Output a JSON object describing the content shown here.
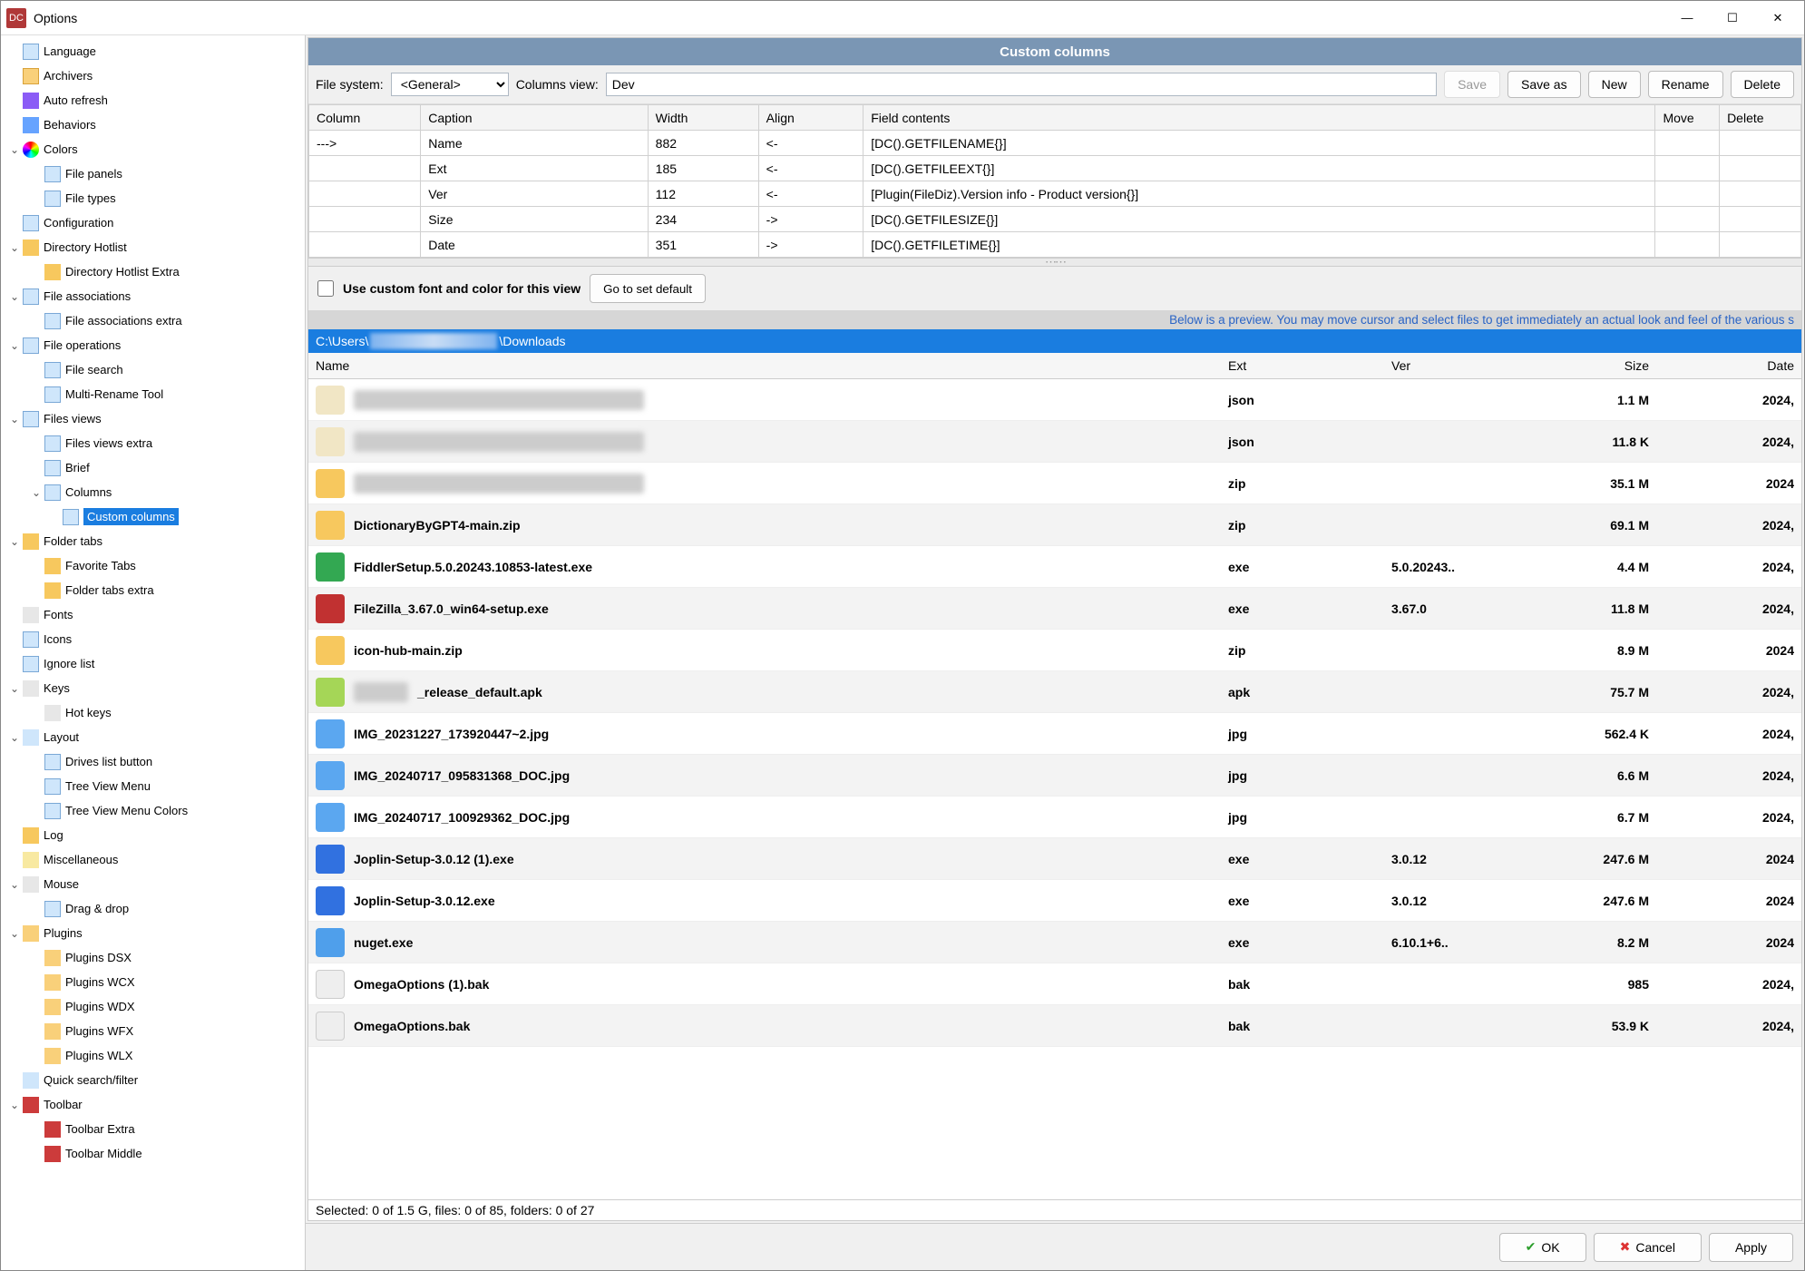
{
  "title": "Options",
  "sidebar": {
    "items": [
      {
        "label": "Language",
        "lvl": 0,
        "exp": "",
        "icoClass": "ico-blue"
      },
      {
        "label": "Archivers",
        "lvl": 0,
        "exp": "",
        "icoClass": "ico-orange"
      },
      {
        "label": "Auto refresh",
        "lvl": 0,
        "exp": "",
        "icoClass": "ico-purple"
      },
      {
        "label": "Behaviors",
        "lvl": 0,
        "exp": "",
        "icoClass": "ico-video"
      },
      {
        "label": "Colors",
        "lvl": 0,
        "exp": "⌄",
        "icoClass": "ico-color"
      },
      {
        "label": "File panels",
        "lvl": 1,
        "exp": "",
        "icoClass": "ico-blue"
      },
      {
        "label": "File types",
        "lvl": 1,
        "exp": "",
        "icoClass": "ico-blue"
      },
      {
        "label": "Configuration",
        "lvl": 0,
        "exp": "",
        "icoClass": "ico-blue"
      },
      {
        "label": "Directory Hotlist",
        "lvl": 0,
        "exp": "⌄",
        "icoClass": "ico-folder"
      },
      {
        "label": "Directory Hotlist Extra",
        "lvl": 1,
        "exp": "",
        "icoClass": "ico-folder"
      },
      {
        "label": "File associations",
        "lvl": 0,
        "exp": "⌄",
        "icoClass": "ico-blue"
      },
      {
        "label": "File associations extra",
        "lvl": 1,
        "exp": "",
        "icoClass": "ico-blue"
      },
      {
        "label": "File operations",
        "lvl": 0,
        "exp": "⌄",
        "icoClass": "ico-blue"
      },
      {
        "label": "File search",
        "lvl": 1,
        "exp": "",
        "icoClass": "ico-blue"
      },
      {
        "label": "Multi-Rename Tool",
        "lvl": 1,
        "exp": "",
        "icoClass": "ico-blue"
      },
      {
        "label": "Files views",
        "lvl": 0,
        "exp": "⌄",
        "icoClass": "ico-blue"
      },
      {
        "label": "Files views extra",
        "lvl": 1,
        "exp": "",
        "icoClass": "ico-blue"
      },
      {
        "label": "Brief",
        "lvl": 1,
        "exp": "",
        "icoClass": "ico-blue"
      },
      {
        "label": "Columns",
        "lvl": 1,
        "exp": "⌄",
        "icoClass": "ico-blue"
      },
      {
        "label": "Custom columns",
        "lvl": 2,
        "exp": "",
        "icoClass": "ico-blue",
        "selected": true
      },
      {
        "label": "Folder tabs",
        "lvl": 0,
        "exp": "⌄",
        "icoClass": "ico-folder"
      },
      {
        "label": "Favorite Tabs",
        "lvl": 1,
        "exp": "",
        "icoClass": "ico-folder"
      },
      {
        "label": "Folder tabs extra",
        "lvl": 1,
        "exp": "",
        "icoClass": "ico-folder"
      },
      {
        "label": "Fonts",
        "lvl": 0,
        "exp": "",
        "icoClass": "ico-font"
      },
      {
        "label": "Icons",
        "lvl": 0,
        "exp": "",
        "icoClass": "ico-blue"
      },
      {
        "label": "Ignore list",
        "lvl": 0,
        "exp": "",
        "icoClass": "ico-blue"
      },
      {
        "label": "Keys",
        "lvl": 0,
        "exp": "⌄",
        "icoClass": "ico-keys"
      },
      {
        "label": "Hot keys",
        "lvl": 1,
        "exp": "",
        "icoClass": "ico-keys"
      },
      {
        "label": "Layout",
        "lvl": 0,
        "exp": "⌄",
        "icoClass": "ico-layout"
      },
      {
        "label": "Drives list button",
        "lvl": 1,
        "exp": "",
        "icoClass": "ico-blue"
      },
      {
        "label": "Tree View Menu",
        "lvl": 1,
        "exp": "",
        "icoClass": "ico-blue"
      },
      {
        "label": "Tree View Menu Colors",
        "lvl": 1,
        "exp": "",
        "icoClass": "ico-blue"
      },
      {
        "label": "Log",
        "lvl": 0,
        "exp": "",
        "icoClass": "ico-log"
      },
      {
        "label": "Miscellaneous",
        "lvl": 0,
        "exp": "",
        "icoClass": "ico-misc"
      },
      {
        "label": "Mouse",
        "lvl": 0,
        "exp": "⌄",
        "icoClass": "ico-mouse"
      },
      {
        "label": "Drag & drop",
        "lvl": 1,
        "exp": "",
        "icoClass": "ico-blue"
      },
      {
        "label": "Plugins",
        "lvl": 0,
        "exp": "⌄",
        "icoClass": "ico-plug"
      },
      {
        "label": "Plugins DSX",
        "lvl": 1,
        "exp": "",
        "icoClass": "ico-plug"
      },
      {
        "label": "Plugins WCX",
        "lvl": 1,
        "exp": "",
        "icoClass": "ico-plug"
      },
      {
        "label": "Plugins WDX",
        "lvl": 1,
        "exp": "",
        "icoClass": "ico-plug"
      },
      {
        "label": "Plugins WFX",
        "lvl": 1,
        "exp": "",
        "icoClass": "ico-plug"
      },
      {
        "label": "Plugins WLX",
        "lvl": 1,
        "exp": "",
        "icoClass": "ico-plug"
      },
      {
        "label": "Quick search/filter",
        "lvl": 0,
        "exp": "",
        "icoClass": "ico-filter"
      },
      {
        "label": "Toolbar",
        "lvl": 0,
        "exp": "⌄",
        "icoClass": "ico-tool"
      },
      {
        "label": "Toolbar Extra",
        "lvl": 1,
        "exp": "",
        "icoClass": "ico-tool"
      },
      {
        "label": "Toolbar Middle",
        "lvl": 1,
        "exp": "",
        "icoClass": "ico-tool"
      }
    ]
  },
  "header": "Custom columns",
  "form": {
    "fs_label": "File system:",
    "fs_value": "<General>",
    "cv_label": "Columns view:",
    "cv_value": "Dev",
    "save": "Save",
    "saveas": "Save as",
    "new": "New",
    "rename": "Rename",
    "delete": "Delete"
  },
  "cols_table": {
    "headers": [
      "Column",
      "Caption",
      "Width",
      "Align",
      "Field contents",
      "Move",
      "Delete"
    ],
    "rows": [
      [
        "--->",
        "Name",
        "882",
        "<-",
        "[DC().GETFILENAME{}]",
        "",
        ""
      ],
      [
        "",
        "Ext",
        "185",
        "<-",
        "[DC().GETFILEEXT{}]",
        "",
        ""
      ],
      [
        "",
        "Ver",
        "112",
        "<-",
        "[Plugin(FileDiz).Version info - Product version{}]",
        "",
        ""
      ],
      [
        "",
        "Size",
        "234",
        "->",
        "[DC().GETFILESIZE{}]",
        "",
        ""
      ],
      [
        "",
        "Date",
        "351",
        "->",
        "[DC().GETFILETIME{}]",
        "",
        ""
      ]
    ]
  },
  "custom_font_label": "Use custom font and color for this view",
  "go_default": "Go to set default",
  "preview_note": "Below is a preview. You may move cursor and select files to get immediately an actual look and feel of the various s",
  "path_prefix": "C:\\Users\\",
  "path_suffix": "\\Downloads",
  "file_headers": {
    "name": "Name",
    "ext": "Ext",
    "ver": "Ver",
    "size": "Size",
    "date": "Date"
  },
  "files": [
    {
      "name": "",
      "blur": true,
      "ico": "fico-json",
      "ext": "json",
      "ver": "",
      "size": "1.1 M",
      "date": "2024,"
    },
    {
      "name": "",
      "blur": true,
      "ico": "fico-json",
      "ext": "json",
      "ver": "",
      "size": "11.8 K",
      "date": "2024,"
    },
    {
      "name": "",
      "blur": true,
      "ico": "fico-zip",
      "ext": "zip",
      "ver": "",
      "size": "35.1 M",
      "date": "2024"
    },
    {
      "name": "DictionaryByGPT4-main.zip",
      "ico": "fico-zip",
      "ext": "zip",
      "ver": "",
      "size": "69.1 M",
      "date": "2024,"
    },
    {
      "name": "FiddlerSetup.5.0.20243.10853-latest.exe",
      "ico": "fico-exe",
      "ext": "exe",
      "ver": "5.0.20243..",
      "size": "4.4 M",
      "date": "2024,"
    },
    {
      "name": "FileZilla_3.67.0_win64-setup.exe",
      "ico": "fico-fz",
      "ext": "exe",
      "ver": "3.67.0",
      "size": "11.8 M",
      "date": "2024,"
    },
    {
      "name": "icon-hub-main.zip",
      "ico": "fico-zip",
      "ext": "zip",
      "ver": "",
      "size": "8.9 M",
      "date": "2024"
    },
    {
      "name": "_release_default.apk",
      "blurprefix": true,
      "ico": "fico-apk",
      "ext": "apk",
      "ver": "",
      "size": "75.7 M",
      "date": "2024,"
    },
    {
      "name": "IMG_20231227_173920447~2.jpg",
      "ico": "fico-jpg",
      "ext": "jpg",
      "ver": "",
      "size": "562.4 K",
      "date": "2024,"
    },
    {
      "name": "IMG_20240717_095831368_DOC.jpg",
      "ico": "fico-jpg",
      "ext": "jpg",
      "ver": "",
      "size": "6.6 M",
      "date": "2024,"
    },
    {
      "name": "IMG_20240717_100929362_DOC.jpg",
      "ico": "fico-jpg",
      "ext": "jpg",
      "ver": "",
      "size": "6.7 M",
      "date": "2024,"
    },
    {
      "name": "Joplin-Setup-3.0.12 (1).exe",
      "ico": "fico-j",
      "ext": "exe",
      "ver": "3.0.12",
      "size": "247.6 M",
      "date": "2024"
    },
    {
      "name": "Joplin-Setup-3.0.12.exe",
      "ico": "fico-j",
      "ext": "exe",
      "ver": "3.0.12",
      "size": "247.6 M",
      "date": "2024"
    },
    {
      "name": "nuget.exe",
      "ico": "fico-nuget",
      "ext": "exe",
      "ver": "6.10.1+6..",
      "size": "8.2 M",
      "date": "2024"
    },
    {
      "name": "OmegaOptions (1).bak",
      "ico": "fico-bak",
      "ext": "bak",
      "ver": "",
      "size": "985",
      "date": "2024,"
    },
    {
      "name": "OmegaOptions.bak",
      "ico": "fico-bak",
      "ext": "bak",
      "ver": "",
      "size": "53.9 K",
      "date": "2024,"
    }
  ],
  "status": "Selected: 0 of 1.5 G, files: 0 of 85, folders: 0 of 27",
  "footer": {
    "ok": "OK",
    "cancel": "Cancel",
    "apply": "Apply"
  }
}
